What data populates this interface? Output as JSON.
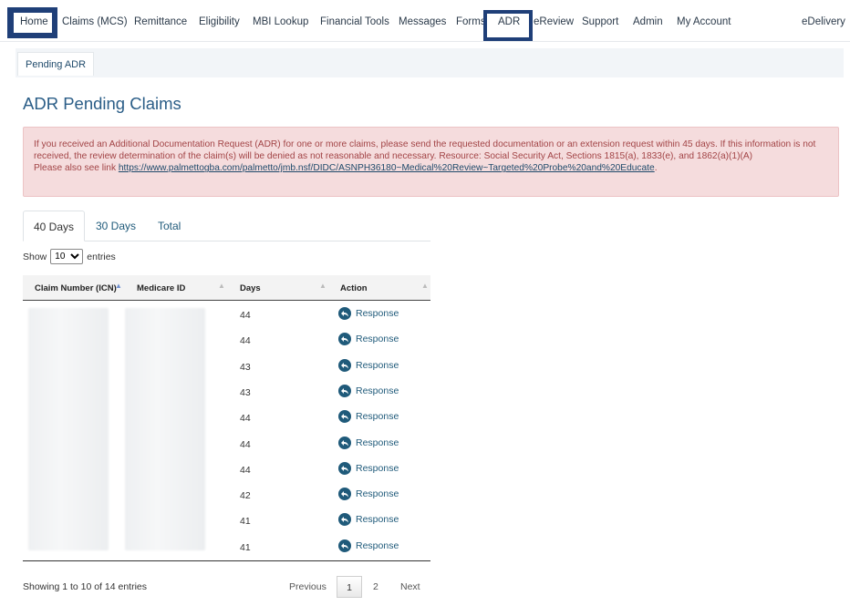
{
  "nav": {
    "items": [
      {
        "label": "Home"
      },
      {
        "label": "Claims (MCS)"
      },
      {
        "label": "Remittance"
      },
      {
        "label": "Eligibility"
      },
      {
        "label": "MBI Lookup"
      },
      {
        "label": "Financial Tools"
      },
      {
        "label": "Messages"
      },
      {
        "label": "Forms"
      },
      {
        "label": "ADR"
      },
      {
        "label": "eReview"
      },
      {
        "label": "Support"
      },
      {
        "label": "Admin"
      },
      {
        "label": "My Account"
      },
      {
        "label": "eDelivery"
      }
    ]
  },
  "subnav": {
    "tab": "Pending ADR"
  },
  "page": {
    "title": "ADR Pending Claims"
  },
  "alert": {
    "text1": "If you received an Additional Documentation Request (ADR) for one or more claims, please send the requested documentation or an extension request within 45 days. If this information is not received, the review determination of the claim(s) will be denied as not reasonable and necessary. Resource: Social Security Act, Sections 1815(a), 1833(e), and 1862(a)(1)(A)",
    "text2": "Please also see link ",
    "link": "https://www.palmettogba.com/palmetto/jmb.nsf/DIDC/ASNPH36180~Medical%20Review~Targeted%20Probe%20and%20Educate",
    "text3": "."
  },
  "tabs": [
    {
      "label": "40 Days"
    },
    {
      "label": "30 Days"
    },
    {
      "label": "Total"
    }
  ],
  "entries": {
    "show": "Show",
    "value": "10",
    "suffix": "entries",
    "options": [
      "10"
    ]
  },
  "table": {
    "headers": {
      "claim": "Claim Number (ICN)",
      "medicare": "Medicare ID",
      "days": "Days",
      "action": "Action"
    },
    "rows": [
      {
        "days": "44",
        "action": "Response"
      },
      {
        "days": "44",
        "action": "Response"
      },
      {
        "days": "43",
        "action": "Response"
      },
      {
        "days": "43",
        "action": "Response"
      },
      {
        "days": "44",
        "action": "Response"
      },
      {
        "days": "44",
        "action": "Response"
      },
      {
        "days": "44",
        "action": "Response"
      },
      {
        "days": "42",
        "action": "Response"
      },
      {
        "days": "41",
        "action": "Response"
      },
      {
        "days": "41",
        "action": "Response"
      }
    ]
  },
  "footer": {
    "info": "Showing 1 to 10 of 14 entries",
    "previous": "Previous",
    "page1": "1",
    "page2": "2",
    "next": "Next"
  },
  "colors": {
    "nav_highlight": "#1f3f78",
    "link": "#1f5a7a",
    "alert_bg": "#f5dcdd",
    "alert_text": "#a24446"
  }
}
